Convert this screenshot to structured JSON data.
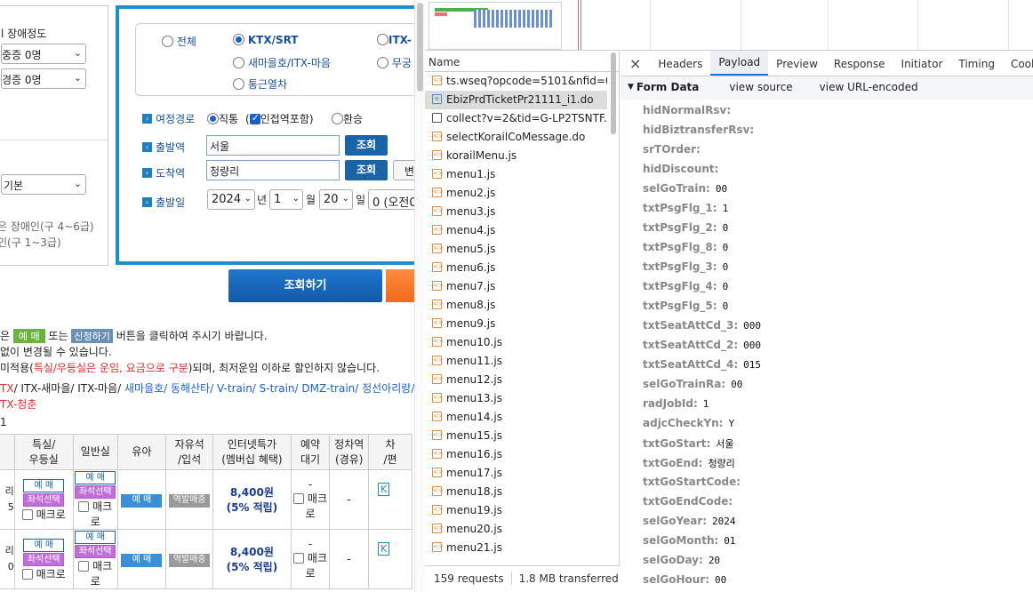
{
  "left": {
    "panel": {
      "title_partial": "l 장애정도",
      "select1": "중증 0명",
      "select2": "경증 0명",
      "select3": "기본",
      "note1": "은 장애인(구 4~6급)",
      "note2": "인(구 1~3급)"
    },
    "train_types": {
      "all": "전체",
      "ktx": "KTX/SRT",
      "itx_partial": "ITX-",
      "saemaeul": "새마을호/ITX-마음",
      "mugung_partial": "무궁",
      "commuter": "통근열차"
    },
    "route": {
      "label": "여정경로",
      "direct": "직통",
      "adjacent": "인접역포함",
      "transfer": "환승"
    },
    "departure": {
      "label": "출발역",
      "value": "서울",
      "button": "조회"
    },
    "arrival": {
      "label": "도착역",
      "value": "청량리",
      "button": "조회",
      "extra_partial": "변"
    },
    "date": {
      "label": "출발일",
      "year": "2024",
      "year_unit": "년",
      "month": "1",
      "month_unit": "월",
      "day": "20",
      "day_unit": "일",
      "hour": "0 (오전0"
    },
    "search_button": "조회하기",
    "notice": {
      "l1_pre": "은",
      "l1_tag1": "예 매",
      "l1_mid": "또는",
      "l1_tag2": "신청하기",
      "l1_post": "버튼을 클릭하여 주시기 바랍니다.",
      "l2": "없이 변경될 수 있습니다.",
      "l3_pre": "미적용(",
      "l3_red": "특실/우등실은 운임, 요금으로 구분",
      "l3_post": ")되며, 최저운임 이하로 할인하지 않습니다.",
      "l4_a": "TX",
      "l4_b": "/ ITX-새마을/ ITX-마음/",
      "l4_c": "새마을호/ 동해산타/ V-train/ S-train/ DMZ-train/ 정선아리랑/",
      "l5": "TX-청춘",
      "l6": "1"
    },
    "table": {
      "headers": [
        "",
        "특실/\n우등실",
        "일반실",
        "유아",
        "자유석\n/입석",
        "인터넷특가\n(멤버십 혜택)",
        "예약\n대기",
        "정차역\n(경유)",
        "차\n/편"
      ],
      "rows": [
        {
          "c0a": "리",
          "c0b": "5",
          "reserve": "예 매",
          "seat": "좌석선택",
          "macro": "매크로",
          "infant": "예 매",
          "standing": "역발매중",
          "price": "8,400원",
          "points": "(5% 적립)",
          "wait": "-",
          "wait_macro": "매크로",
          "stops": "-",
          "k": "K"
        },
        {
          "c0a": "리",
          "c0b": "0",
          "reserve": "예 매",
          "seat": "좌석선택",
          "macro": "매크로",
          "infant": "예 매",
          "standing": "역발매중",
          "price": "8,400원",
          "points": "(5% 적립)",
          "wait": "-",
          "wait_macro": "매크로",
          "stops": "-",
          "k": "K"
        }
      ]
    }
  },
  "devtools": {
    "name_header": "Name",
    "requests": [
      {
        "name": "ts.wseq?opcode=5101&nfid=0...",
        "icon": "script-icon"
      },
      {
        "name": "EbizPrdTicketPr21111_i1.do",
        "icon": "document-icon",
        "selected": true
      },
      {
        "name": "collect?v=2&tid=G-LP2TSNTF...",
        "icon": "checkbox-icon"
      },
      {
        "name": "selectKorailCoMessage.do",
        "icon": "script-icon"
      },
      {
        "name": "korailMenu.js",
        "icon": "script-icon"
      },
      {
        "name": "menu1.js",
        "icon": "script-icon"
      },
      {
        "name": "menu2.js",
        "icon": "script-icon"
      },
      {
        "name": "menu3.js",
        "icon": "script-icon"
      },
      {
        "name": "menu4.js",
        "icon": "script-icon"
      },
      {
        "name": "menu5.js",
        "icon": "script-icon"
      },
      {
        "name": "menu6.js",
        "icon": "script-icon"
      },
      {
        "name": "menu7.js",
        "icon": "script-icon"
      },
      {
        "name": "menu8.js",
        "icon": "script-icon"
      },
      {
        "name": "menu9.js",
        "icon": "script-icon"
      },
      {
        "name": "menu10.js",
        "icon": "script-icon"
      },
      {
        "name": "menu11.js",
        "icon": "script-icon"
      },
      {
        "name": "menu12.js",
        "icon": "script-icon"
      },
      {
        "name": "menu13.js",
        "icon": "script-icon"
      },
      {
        "name": "menu14.js",
        "icon": "script-icon"
      },
      {
        "name": "menu15.js",
        "icon": "script-icon"
      },
      {
        "name": "menu16.js",
        "icon": "script-icon"
      },
      {
        "name": "menu17.js",
        "icon": "script-icon"
      },
      {
        "name": "menu18.js",
        "icon": "script-icon"
      },
      {
        "name": "menu19.js",
        "icon": "script-icon"
      },
      {
        "name": "menu20.js",
        "icon": "script-icon"
      },
      {
        "name": "menu21.js",
        "icon": "script-icon"
      }
    ],
    "footer": {
      "requests": "159 requests",
      "transferred": "1.8 MB transferred"
    },
    "tabs": [
      "Headers",
      "Payload",
      "Preview",
      "Response",
      "Initiator",
      "Timing",
      "Cookies"
    ],
    "active_tab": "Payload",
    "form_data": {
      "title": "Form Data",
      "view_source": "view source",
      "view_url": "view URL-encoded",
      "fields": [
        {
          "k": "hidNormalRsv:",
          "v": ""
        },
        {
          "k": "hidBiztransferRsv:",
          "v": ""
        },
        {
          "k": "srTOrder:",
          "v": ""
        },
        {
          "k": "hidDiscount:",
          "v": ""
        },
        {
          "k": "selGoTrain:",
          "v": "00"
        },
        {
          "k": "txtPsgFlg_1:",
          "v": "1"
        },
        {
          "k": "txtPsgFlg_2:",
          "v": "0"
        },
        {
          "k": "txtPsgFlg_8:",
          "v": "0"
        },
        {
          "k": "txtPsgFlg_3:",
          "v": "0"
        },
        {
          "k": "txtPsgFlg_4:",
          "v": "0"
        },
        {
          "k": "txtPsgFlg_5:",
          "v": "0"
        },
        {
          "k": "txtSeatAttCd_3:",
          "v": "000"
        },
        {
          "k": "txtSeatAttCd_2:",
          "v": "000"
        },
        {
          "k": "txtSeatAttCd_4:",
          "v": "015"
        },
        {
          "k": "selGoTrainRa:",
          "v": "00"
        },
        {
          "k": "radJobId:",
          "v": "1"
        },
        {
          "k": "adjcCheckYn:",
          "v": "Y"
        },
        {
          "k": "txtGoStart:",
          "v": "서울"
        },
        {
          "k": "txtGoEnd:",
          "v": "청량리"
        },
        {
          "k": "txtGoStartCode:",
          "v": ""
        },
        {
          "k": "txtGoEndCode:",
          "v": ""
        },
        {
          "k": "selGoYear:",
          "v": "2024"
        },
        {
          "k": "selGoMonth:",
          "v": "01"
        },
        {
          "k": "selGoDay:",
          "v": "20"
        },
        {
          "k": "selGoHour:",
          "v": "00"
        }
      ]
    }
  }
}
